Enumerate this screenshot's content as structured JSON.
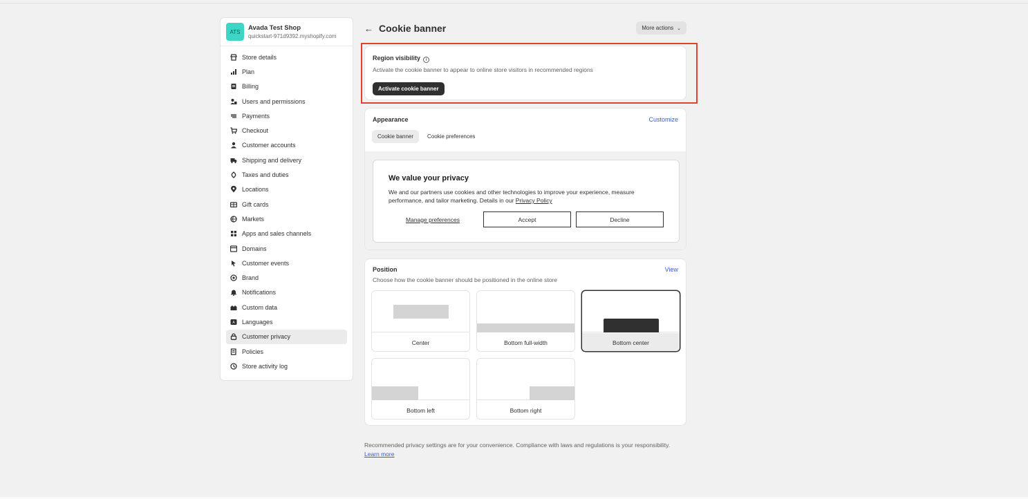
{
  "shop": {
    "initials": "ATS",
    "name": "Avada Test Shop",
    "domain": "quickstart-971d9392.myshopify.com"
  },
  "nav": [
    {
      "label": "Store details",
      "icon": "store-icon"
    },
    {
      "label": "Plan",
      "icon": "plan-icon"
    },
    {
      "label": "Billing",
      "icon": "billing-icon"
    },
    {
      "label": "Users and permissions",
      "icon": "users-icon"
    },
    {
      "label": "Payments",
      "icon": "payments-icon"
    },
    {
      "label": "Checkout",
      "icon": "cart-icon"
    },
    {
      "label": "Customer accounts",
      "icon": "person-icon"
    },
    {
      "label": "Shipping and delivery",
      "icon": "truck-icon"
    },
    {
      "label": "Taxes and duties",
      "icon": "tax-icon"
    },
    {
      "label": "Locations",
      "icon": "location-icon"
    },
    {
      "label": "Gift cards",
      "icon": "gift-card-icon"
    },
    {
      "label": "Markets",
      "icon": "globe-icon"
    },
    {
      "label": "Apps and sales channels",
      "icon": "apps-icon"
    },
    {
      "label": "Domains",
      "icon": "domain-icon"
    },
    {
      "label": "Customer events",
      "icon": "cursor-icon"
    },
    {
      "label": "Brand",
      "icon": "brand-icon"
    },
    {
      "label": "Notifications",
      "icon": "bell-icon"
    },
    {
      "label": "Custom data",
      "icon": "data-icon"
    },
    {
      "label": "Languages",
      "icon": "language-icon"
    },
    {
      "label": "Customer privacy",
      "icon": "lock-icon",
      "active": true
    },
    {
      "label": "Policies",
      "icon": "policy-icon"
    },
    {
      "label": "Store activity log",
      "icon": "activity-icon"
    }
  ],
  "header": {
    "back": "←",
    "title": "Cookie banner",
    "more_actions": "More actions"
  },
  "region": {
    "title": "Region visibility",
    "subtitle": "Activate the cookie banner to appear to online store visitors in recommended regions",
    "button": "Activate cookie banner"
  },
  "appearance": {
    "title": "Appearance",
    "customize": "Customize",
    "tabs": [
      "Cookie banner",
      "Cookie preferences"
    ],
    "preview": {
      "title": "We value your privacy",
      "body": "We and our partners use cookies and other technologies to improve your experience, measure performance, and tailor marketing. Details in our",
      "policy_link": "Privacy Policy",
      "manage": "Manage preferences",
      "accept": "Accept",
      "decline": "Decline"
    }
  },
  "position": {
    "title": "Position",
    "view": "View",
    "subtitle": "Choose how the cookie banner should be positioned in the online store",
    "options": [
      "Center",
      "Bottom full-width",
      "Bottom center",
      "Bottom left",
      "Bottom right"
    ],
    "selected": "Bottom center"
  },
  "footer": {
    "text": "Recommended privacy settings are for your convenience. Compliance with laws and regulations is your responsibility.",
    "link": "Learn more"
  }
}
